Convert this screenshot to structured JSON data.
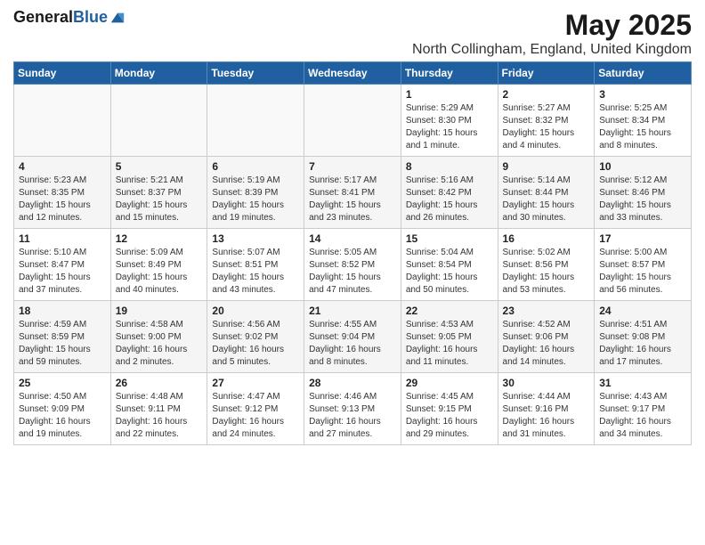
{
  "header": {
    "logo_general": "General",
    "logo_blue": "Blue",
    "month_title": "May 2025",
    "location": "North Collingham, England, United Kingdom"
  },
  "days_of_week": [
    "Sunday",
    "Monday",
    "Tuesday",
    "Wednesday",
    "Thursday",
    "Friday",
    "Saturday"
  ],
  "weeks": [
    [
      {
        "day": "",
        "info": ""
      },
      {
        "day": "",
        "info": ""
      },
      {
        "day": "",
        "info": ""
      },
      {
        "day": "",
        "info": ""
      },
      {
        "day": "1",
        "info": "Sunrise: 5:29 AM\nSunset: 8:30 PM\nDaylight: 15 hours\nand 1 minute."
      },
      {
        "day": "2",
        "info": "Sunrise: 5:27 AM\nSunset: 8:32 PM\nDaylight: 15 hours\nand 4 minutes."
      },
      {
        "day": "3",
        "info": "Sunrise: 5:25 AM\nSunset: 8:34 PM\nDaylight: 15 hours\nand 8 minutes."
      }
    ],
    [
      {
        "day": "4",
        "info": "Sunrise: 5:23 AM\nSunset: 8:35 PM\nDaylight: 15 hours\nand 12 minutes."
      },
      {
        "day": "5",
        "info": "Sunrise: 5:21 AM\nSunset: 8:37 PM\nDaylight: 15 hours\nand 15 minutes."
      },
      {
        "day": "6",
        "info": "Sunrise: 5:19 AM\nSunset: 8:39 PM\nDaylight: 15 hours\nand 19 minutes."
      },
      {
        "day": "7",
        "info": "Sunrise: 5:17 AM\nSunset: 8:41 PM\nDaylight: 15 hours\nand 23 minutes."
      },
      {
        "day": "8",
        "info": "Sunrise: 5:16 AM\nSunset: 8:42 PM\nDaylight: 15 hours\nand 26 minutes."
      },
      {
        "day": "9",
        "info": "Sunrise: 5:14 AM\nSunset: 8:44 PM\nDaylight: 15 hours\nand 30 minutes."
      },
      {
        "day": "10",
        "info": "Sunrise: 5:12 AM\nSunset: 8:46 PM\nDaylight: 15 hours\nand 33 minutes."
      }
    ],
    [
      {
        "day": "11",
        "info": "Sunrise: 5:10 AM\nSunset: 8:47 PM\nDaylight: 15 hours\nand 37 minutes."
      },
      {
        "day": "12",
        "info": "Sunrise: 5:09 AM\nSunset: 8:49 PM\nDaylight: 15 hours\nand 40 minutes."
      },
      {
        "day": "13",
        "info": "Sunrise: 5:07 AM\nSunset: 8:51 PM\nDaylight: 15 hours\nand 43 minutes."
      },
      {
        "day": "14",
        "info": "Sunrise: 5:05 AM\nSunset: 8:52 PM\nDaylight: 15 hours\nand 47 minutes."
      },
      {
        "day": "15",
        "info": "Sunrise: 5:04 AM\nSunset: 8:54 PM\nDaylight: 15 hours\nand 50 minutes."
      },
      {
        "day": "16",
        "info": "Sunrise: 5:02 AM\nSunset: 8:56 PM\nDaylight: 15 hours\nand 53 minutes."
      },
      {
        "day": "17",
        "info": "Sunrise: 5:00 AM\nSunset: 8:57 PM\nDaylight: 15 hours\nand 56 minutes."
      }
    ],
    [
      {
        "day": "18",
        "info": "Sunrise: 4:59 AM\nSunset: 8:59 PM\nDaylight: 15 hours\nand 59 minutes."
      },
      {
        "day": "19",
        "info": "Sunrise: 4:58 AM\nSunset: 9:00 PM\nDaylight: 16 hours\nand 2 minutes."
      },
      {
        "day": "20",
        "info": "Sunrise: 4:56 AM\nSunset: 9:02 PM\nDaylight: 16 hours\nand 5 minutes."
      },
      {
        "day": "21",
        "info": "Sunrise: 4:55 AM\nSunset: 9:04 PM\nDaylight: 16 hours\nand 8 minutes."
      },
      {
        "day": "22",
        "info": "Sunrise: 4:53 AM\nSunset: 9:05 PM\nDaylight: 16 hours\nand 11 minutes."
      },
      {
        "day": "23",
        "info": "Sunrise: 4:52 AM\nSunset: 9:06 PM\nDaylight: 16 hours\nand 14 minutes."
      },
      {
        "day": "24",
        "info": "Sunrise: 4:51 AM\nSunset: 9:08 PM\nDaylight: 16 hours\nand 17 minutes."
      }
    ],
    [
      {
        "day": "25",
        "info": "Sunrise: 4:50 AM\nSunset: 9:09 PM\nDaylight: 16 hours\nand 19 minutes."
      },
      {
        "day": "26",
        "info": "Sunrise: 4:48 AM\nSunset: 9:11 PM\nDaylight: 16 hours\nand 22 minutes."
      },
      {
        "day": "27",
        "info": "Sunrise: 4:47 AM\nSunset: 9:12 PM\nDaylight: 16 hours\nand 24 minutes."
      },
      {
        "day": "28",
        "info": "Sunrise: 4:46 AM\nSunset: 9:13 PM\nDaylight: 16 hours\nand 27 minutes."
      },
      {
        "day": "29",
        "info": "Sunrise: 4:45 AM\nSunset: 9:15 PM\nDaylight: 16 hours\nand 29 minutes."
      },
      {
        "day": "30",
        "info": "Sunrise: 4:44 AM\nSunset: 9:16 PM\nDaylight: 16 hours\nand 31 minutes."
      },
      {
        "day": "31",
        "info": "Sunrise: 4:43 AM\nSunset: 9:17 PM\nDaylight: 16 hours\nand 34 minutes."
      }
    ]
  ]
}
